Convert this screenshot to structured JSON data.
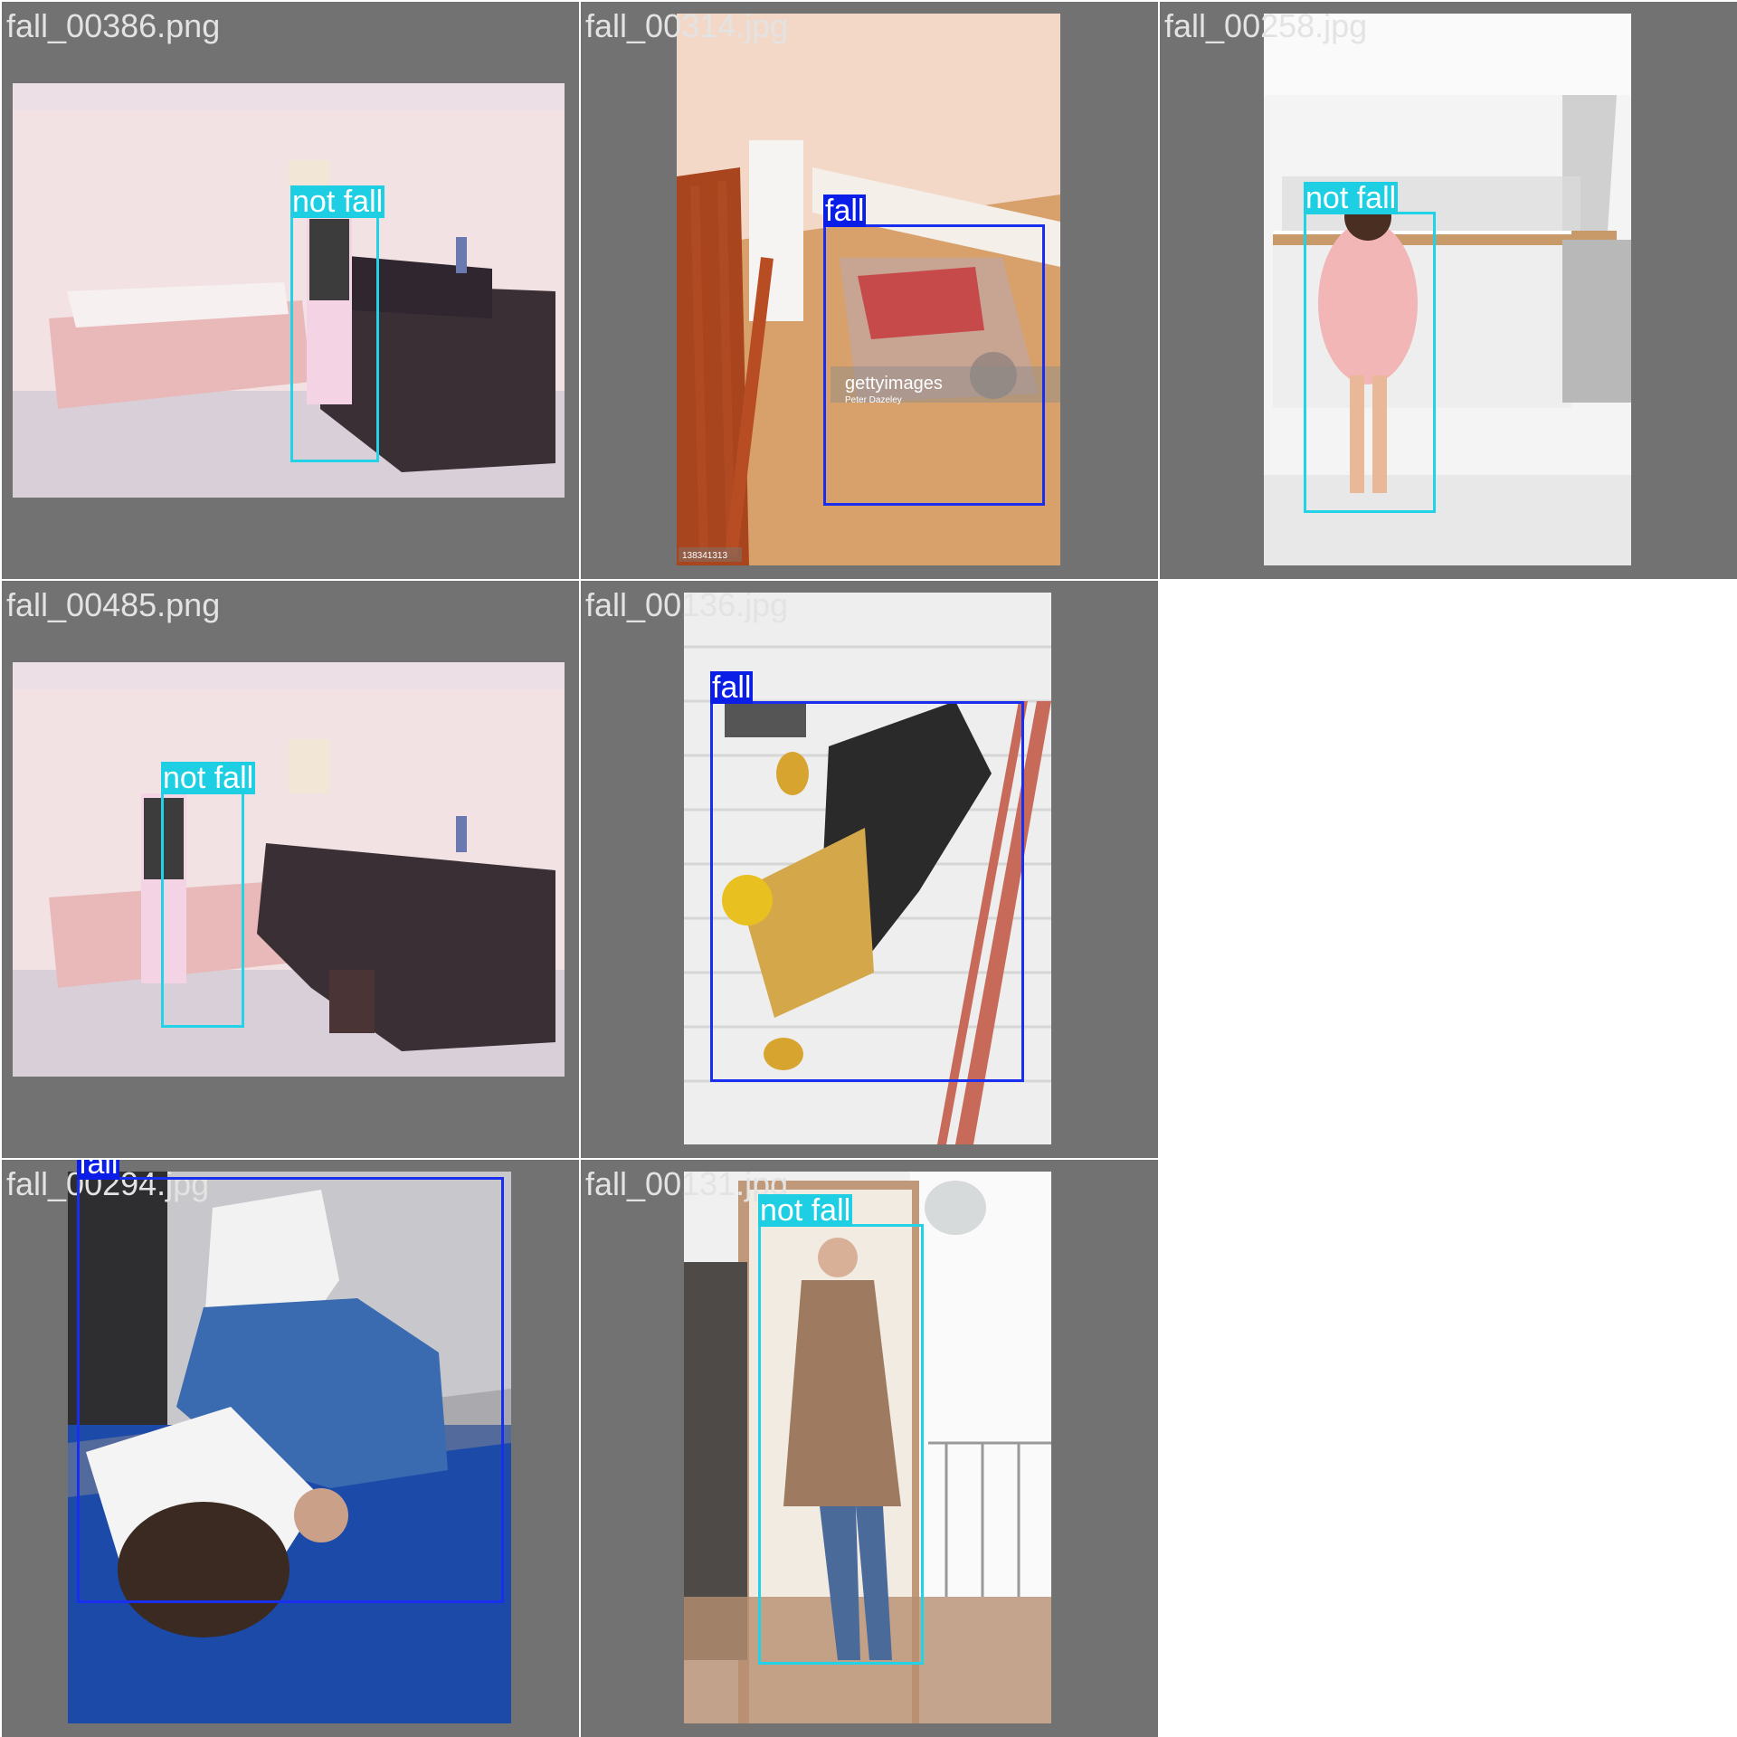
{
  "cells": [
    {
      "filename": "fall_00386.png",
      "detection": {
        "label": "not fall",
        "class": "notfall"
      }
    },
    {
      "filename": "fall_00314.jpg",
      "detection": {
        "label": "fall",
        "class": "fall"
      },
      "watermark": "gettyimages",
      "credit": "Peter Dazeley",
      "image_id": "138341313"
    },
    {
      "filename": "fall_00258.jpg",
      "detection": {
        "label": "not fall",
        "class": "notfall"
      }
    },
    {
      "filename": "fall_00485.png",
      "detection": {
        "label": "not fall",
        "class": "notfall"
      }
    },
    {
      "filename": "fall_00136.jpg",
      "detection": {
        "label": "fall",
        "class": "fall"
      }
    },
    {
      "filename": "fall_00294.jpg",
      "detection": {
        "label": "fall",
        "class": "fall"
      }
    },
    {
      "filename": "fall_00131.jpg",
      "detection": {
        "label": "not fall",
        "class": "notfall"
      }
    }
  ],
  "colors": {
    "fall": "#0a1ee8",
    "not_fall": "#1ecfe3",
    "tile_bg": "#727272",
    "filename_text": "#e3e3e3"
  }
}
